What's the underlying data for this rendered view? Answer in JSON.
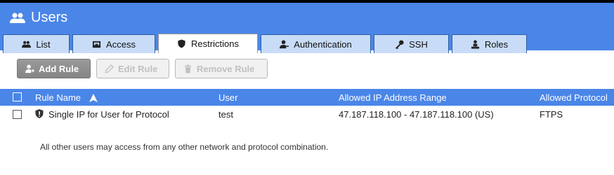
{
  "header": {
    "title": "Users",
    "icon": "users-icon",
    "color": "#4a86e8"
  },
  "tabs": [
    {
      "label": "List",
      "icon": "users-icon"
    },
    {
      "label": "Access",
      "icon": "inbox-icon"
    },
    {
      "label": "Restrictions",
      "icon": "shield-icon",
      "active": true
    },
    {
      "label": "Authentication",
      "icon": "user-key-icon"
    },
    {
      "label": "SSH",
      "icon": "key-icon"
    },
    {
      "label": "Roles",
      "icon": "user-hierarchy-icon"
    }
  ],
  "toolbar": {
    "add_label": "Add Rule",
    "edit_label": "Edit Rule",
    "remove_label": "Remove Rule"
  },
  "table": {
    "columns": [
      "Rule Name",
      "User",
      "Allowed IP Address Range",
      "Allowed Protocol"
    ],
    "sort_column": "Rule Name",
    "sort_direction": "ascending",
    "rows": [
      {
        "name": "Single IP for User for Protocol",
        "user": "test",
        "ip_range": "47.187.118.100 - 47.187.118.100 (US)",
        "protocol": "FTPS"
      }
    ]
  },
  "footnote": "All other users may access from any other network and protocol combination."
}
